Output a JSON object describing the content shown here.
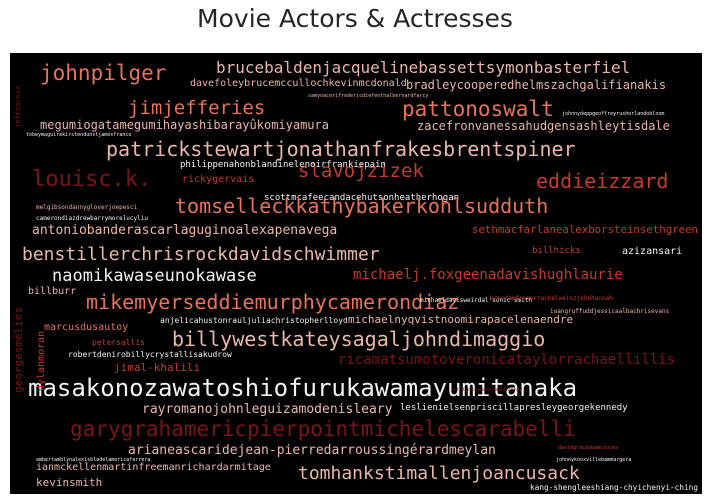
{
  "chart_data": {
    "type": "wordcloud",
    "title": "Movie Actors & Actresses",
    "palette": {
      "background": "#000000",
      "white": "#f2f2f2",
      "light": "#e8b7a8",
      "salmon": "#e6735c",
      "red": "#c43b2f",
      "dark": "#7a1519"
    },
    "words": [
      {
        "text": "johnpilger",
        "weight": 22,
        "color": "salmon"
      },
      {
        "text": "brucebaldenjacquelinebassettsymonbasterfiel",
        "weight": 16,
        "color": "light"
      },
      {
        "text": "davefoleybrucemccullochkevinmcdonald",
        "weight": 8,
        "color": "light"
      },
      {
        "text": "bradleycooperedhelmszachgalifianakis",
        "weight": 11,
        "color": "light"
      },
      {
        "text": "jimjefferies",
        "weight": 18,
        "color": "salmon"
      },
      {
        "text": "pattonoswalt",
        "weight": 22,
        "color": "salmon"
      },
      {
        "text": "megumiogatamegumihayashibarayûkomiyamura",
        "weight": 11,
        "color": "light"
      },
      {
        "text": "zacefronvanessahudgensashleytisdale",
        "weight": 11,
        "color": "light"
      },
      {
        "text": "patrickstewartjonathanfrakesbrentspiner",
        "weight": 19,
        "color": "light"
      },
      {
        "text": "louisc.k.",
        "weight": 22,
        "color": "dark"
      },
      {
        "text": "slavojzizek",
        "weight": 20,
        "color": "red"
      },
      {
        "text": "eddieizzard",
        "weight": 20,
        "color": "red"
      },
      {
        "text": "philippenahonblandinelenoirfrankiepain",
        "weight": 8,
        "color": "white"
      },
      {
        "text": "rickygervais",
        "weight": 10,
        "color": "red"
      },
      {
        "text": "scottmcafeecandacehutsonheatherhogan",
        "weight": 8,
        "color": "white"
      },
      {
        "text": "tomselleckkathybakerkohlsudduth",
        "weight": 20,
        "color": "salmon"
      },
      {
        "text": "antoniobanderascarlaguginoalexapenavega",
        "weight": 12,
        "color": "light"
      },
      {
        "text": "sethmacfarlanealexborsteinsethgreen",
        "weight": 11,
        "color": "red"
      },
      {
        "text": "benstillerchrisrockdavidschwimmer",
        "weight": 17,
        "color": "light"
      },
      {
        "text": "naomikawaseunokawase",
        "weight": 17,
        "color": "white"
      },
      {
        "text": "michaelj.foxgeenadavishughlaurie",
        "weight": 14,
        "color": "red"
      },
      {
        "text": "billhicks",
        "weight": 9,
        "color": "red"
      },
      {
        "text": "azizansari",
        "weight": 10,
        "color": "white"
      },
      {
        "text": "billburr",
        "weight": 10,
        "color": "light"
      },
      {
        "text": "mikemyerseddiemurphycamerondiaz",
        "weight": 20,
        "color": "salmon"
      },
      {
        "text": "michaelnyqvistnoomirapacelenaendre",
        "weight": 11,
        "color": "light"
      },
      {
        "text": "marcusdusautoy",
        "weight": 10,
        "color": "salmon"
      },
      {
        "text": "billywestkateysagaljohndimaggio",
        "weight": 20,
        "color": "light"
      },
      {
        "text": "petersallis",
        "weight": 8,
        "color": "red"
      },
      {
        "text": "robertdenirobillycrystallisakudrow",
        "weight": 8,
        "color": "white"
      },
      {
        "text": "ricamatsumotoveronicataylorrachaellillis",
        "weight": 13,
        "color": "dark"
      },
      {
        "text": "jimal-khalili",
        "weight": 11,
        "color": "red"
      },
      {
        "text": "masakonozawatoshiofurukawamayumitanaka",
        "weight": 24,
        "color": "white"
      },
      {
        "text": "rayromanojohnleguizamodenisleary",
        "weight": 12,
        "color": "light"
      },
      {
        "text": "leslienielsenpriscillapresleygeorgekennedy",
        "weight": 8,
        "color": "white"
      },
      {
        "text": "garygrahamericpierpointmichelescarabelli",
        "weight": 21,
        "color": "dark"
      },
      {
        "text": "arianeascaridejean-pierredarroussingérardmeylan",
        "weight": 12,
        "color": "light"
      },
      {
        "text": "ianmckellenmartinfreemanrichardarmitage",
        "weight": 10,
        "color": "light"
      },
      {
        "text": "tomhankstimallenjoancusack",
        "weight": 18,
        "color": "light"
      },
      {
        "text": "kevinsmith",
        "weight": 10,
        "color": "light"
      },
      {
        "text": "kang-shengleeshiang-chyichenyi-ching",
        "weight": 8,
        "color": "white"
      },
      {
        "text": "georgesméliès",
        "weight": 11,
        "color": "dark"
      },
      {
        "text": "dylanmoran",
        "weight": 10,
        "color": "red"
      },
      {
        "text": "jeffgarcia",
        "weight": 7,
        "color": "dark"
      },
      {
        "text": "anjelicahustonrauljuliachristopherlloyd",
        "weight": 8,
        "color": "white"
      },
      {
        "text": "michaeldavisweirdal'sonic'smith",
        "weight": 6,
        "color": "white"
      },
      {
        "text": "brendanfraserrachelweiszjohnhannah",
        "weight": 6,
        "color": "red"
      },
      {
        "text": "ioangruffuddjessicaalbachrisevans",
        "weight": 6,
        "color": "light"
      },
      {
        "text": "jetlirossamandaamcmurray",
        "weight": 5,
        "color": "dark"
      },
      {
        "text": "melgibsondannygloverjoepesci",
        "weight": 6,
        "color": "light"
      },
      {
        "text": "cameron­diazdrewbarrymorelucyliu",
        "weight": 6,
        "color": "white"
      },
      {
        "text": "johnnydeppgeoffreyrushorlandobloom",
        "weight": 5,
        "color": "white"
      },
      {
        "text": "samynaceri fredericdiefenthalbernardfarcy",
        "weight": 5,
        "color": "light"
      },
      {
        "text": "tobeymaguirekirstendunstjamesfranco",
        "weight": 5,
        "color": "white"
      },
      {
        "text": "johnnyknoxvillebammargera",
        "weight": 5,
        "color": "white"
      },
      {
        "text": "ambertamblynalexisbledelamericaferrera",
        "weight": 5,
        "color": "white"
      },
      {
        "text": "davidgraciebamcinnes",
        "weight": 5,
        "color": "red"
      }
    ]
  }
}
